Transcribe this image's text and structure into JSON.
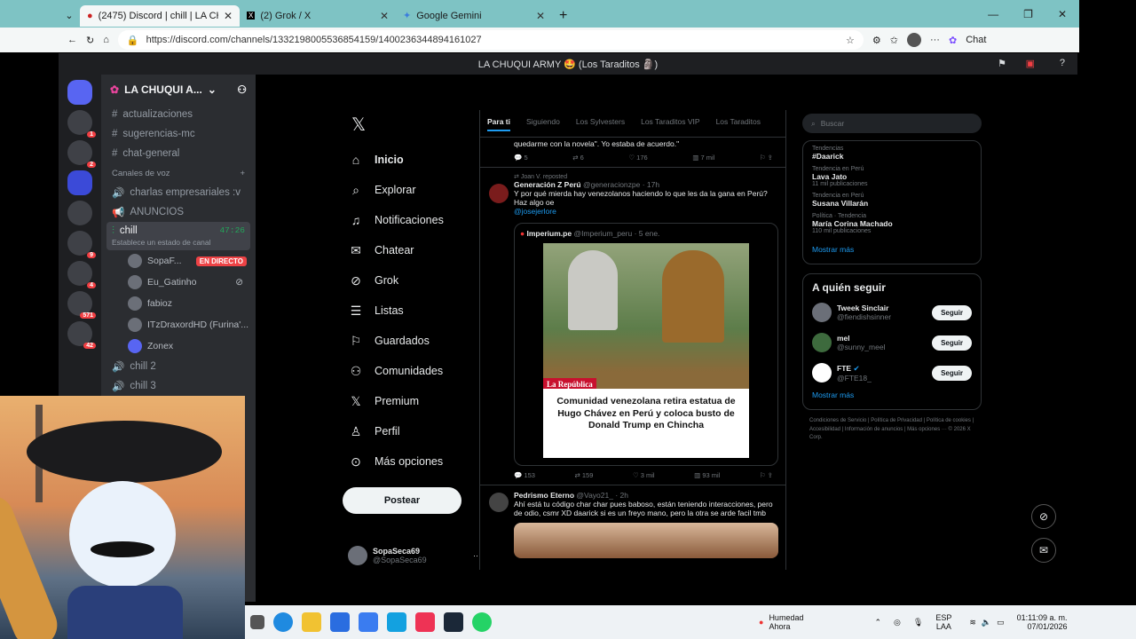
{
  "browser": {
    "tabs": [
      {
        "label": "(2475) Discord | chill | LA CHU",
        "active": true
      },
      {
        "label": "(2) Grok / X",
        "active": false
      },
      {
        "label": "Google Gemini",
        "active": false
      }
    ],
    "url": "https://discord.com/channels/1332198005536854159/1400236344894161027",
    "chat_label": "Chat"
  },
  "discord": {
    "title_bar": "LA CHUQUI ARMY 🤩 (Los Taraditos 🗿)",
    "server_name": "LA CHUQUI A...",
    "channels": [
      "actualizaciones",
      "sugerencias-mc",
      "chat-general"
    ],
    "voice_category": "Canales de voz",
    "voice_channels": [
      "charlas empresariales :v",
      "ANUNCIOS"
    ],
    "active_voice": {
      "name": "chill",
      "time": "47:26",
      "status": "Establece un estado de canal"
    },
    "voice_users": [
      {
        "name": "SopaF...",
        "badge": "EN DIRECTO"
      },
      {
        "name": "Eu_Gatinho"
      },
      {
        "name": "fabioz"
      },
      {
        "name": "ITzDraxordHD (Furina'..."
      },
      {
        "name": "Zonex"
      }
    ],
    "more_channels": [
      "chill 2",
      "chill 3"
    ],
    "guild_badges": [
      "1",
      "2",
      "9",
      "4",
      "571",
      "42"
    ]
  },
  "x": {
    "nav": [
      "Inicio",
      "Explorar",
      "Notificaciones",
      "Chatear",
      "Grok",
      "Listas",
      "Guardados",
      "Comunidades",
      "Premium",
      "Perfil",
      "Más opciones"
    ],
    "post_button": "Postear",
    "profile": {
      "name": "SopaSeca69",
      "handle": "@SopaSeca69"
    },
    "feed_tabs": [
      "Para ti",
      "Siguiendo",
      "Los Sylvesters",
      "Los Taraditos VIP",
      "Los Taraditos"
    ],
    "prev_tweet": {
      "text": "quedarme con la novela\". Yo estaba de acuerdo.\"",
      "stats": [
        "5",
        "6",
        "176",
        "7 mil"
      ]
    },
    "tweet1": {
      "repost": "Joan V. reposted",
      "name": "Generación Z Perú",
      "handle": "@generacionzpe · 17h",
      "text": "Y por qué mierda hay venezolanos haciendo lo que les da la gana en Perú? Haz algo oe",
      "mention": "@josejerlore",
      "quote_name": "Imperium.pe",
      "quote_meta": "@Imperium_peru · 5 ene.",
      "image_label": "La República",
      "headline": "Comunidad venezolana retira estatua de Hugo Chávez en Perú y coloca busto de Donald Trump en Chincha",
      "stats": [
        "153",
        "159",
        "3 mil",
        "93 mil"
      ]
    },
    "tweet2": {
      "name": "Pedrismo Eterno",
      "handle": "@Vayo21_ · 2h",
      "text": "Ahí está tu código char char pues baboso, están teniendo interacciones, pero de odio, csmr XD daarick si es un freyo mano, pero la otra se arde facil tmb"
    },
    "search_placeholder": "Buscar",
    "trends": [
      {
        "context": "Tendencias",
        "title": "#Daarick",
        "count": ""
      },
      {
        "context": "Tendencia en Perú",
        "title": "Lava Jato",
        "count": "11 mil publicaciones"
      },
      {
        "context": "Tendencia en Perú",
        "title": "Susana Villarán",
        "count": ""
      },
      {
        "context": "Política · Tendencia",
        "title": "María Corina Machado",
        "count": "110 mil publicaciones"
      }
    ],
    "show_more": "Mostrar más",
    "who_to_follow": "A quién seguir",
    "follows": [
      {
        "name": "Tweek Sinclair",
        "handle": "@fiendishsinner"
      },
      {
        "name": "mel",
        "handle": "@sunny_meel"
      },
      {
        "name": "FTE",
        "handle": "@FTE18_"
      }
    ],
    "follow_label": "Seguir",
    "footer": "Condiciones de Servicio | Política de Privacidad | Política de cookies | Accesibilidad | Información de anuncios | Más opciones ··· © 2026 X Corp."
  },
  "taskbar": {
    "weather_title": "Humedad",
    "weather_sub": "Ahora",
    "lang1": "ESP",
    "lang2": "LAA",
    "time": "01:11:09 a. m.",
    "date": "07/01/2026"
  },
  "colors": {
    "discord_bg": "#2b2d31",
    "x_bg": "#000000",
    "live_red": "#f23f43",
    "x_blue": "#1d9bf0"
  }
}
